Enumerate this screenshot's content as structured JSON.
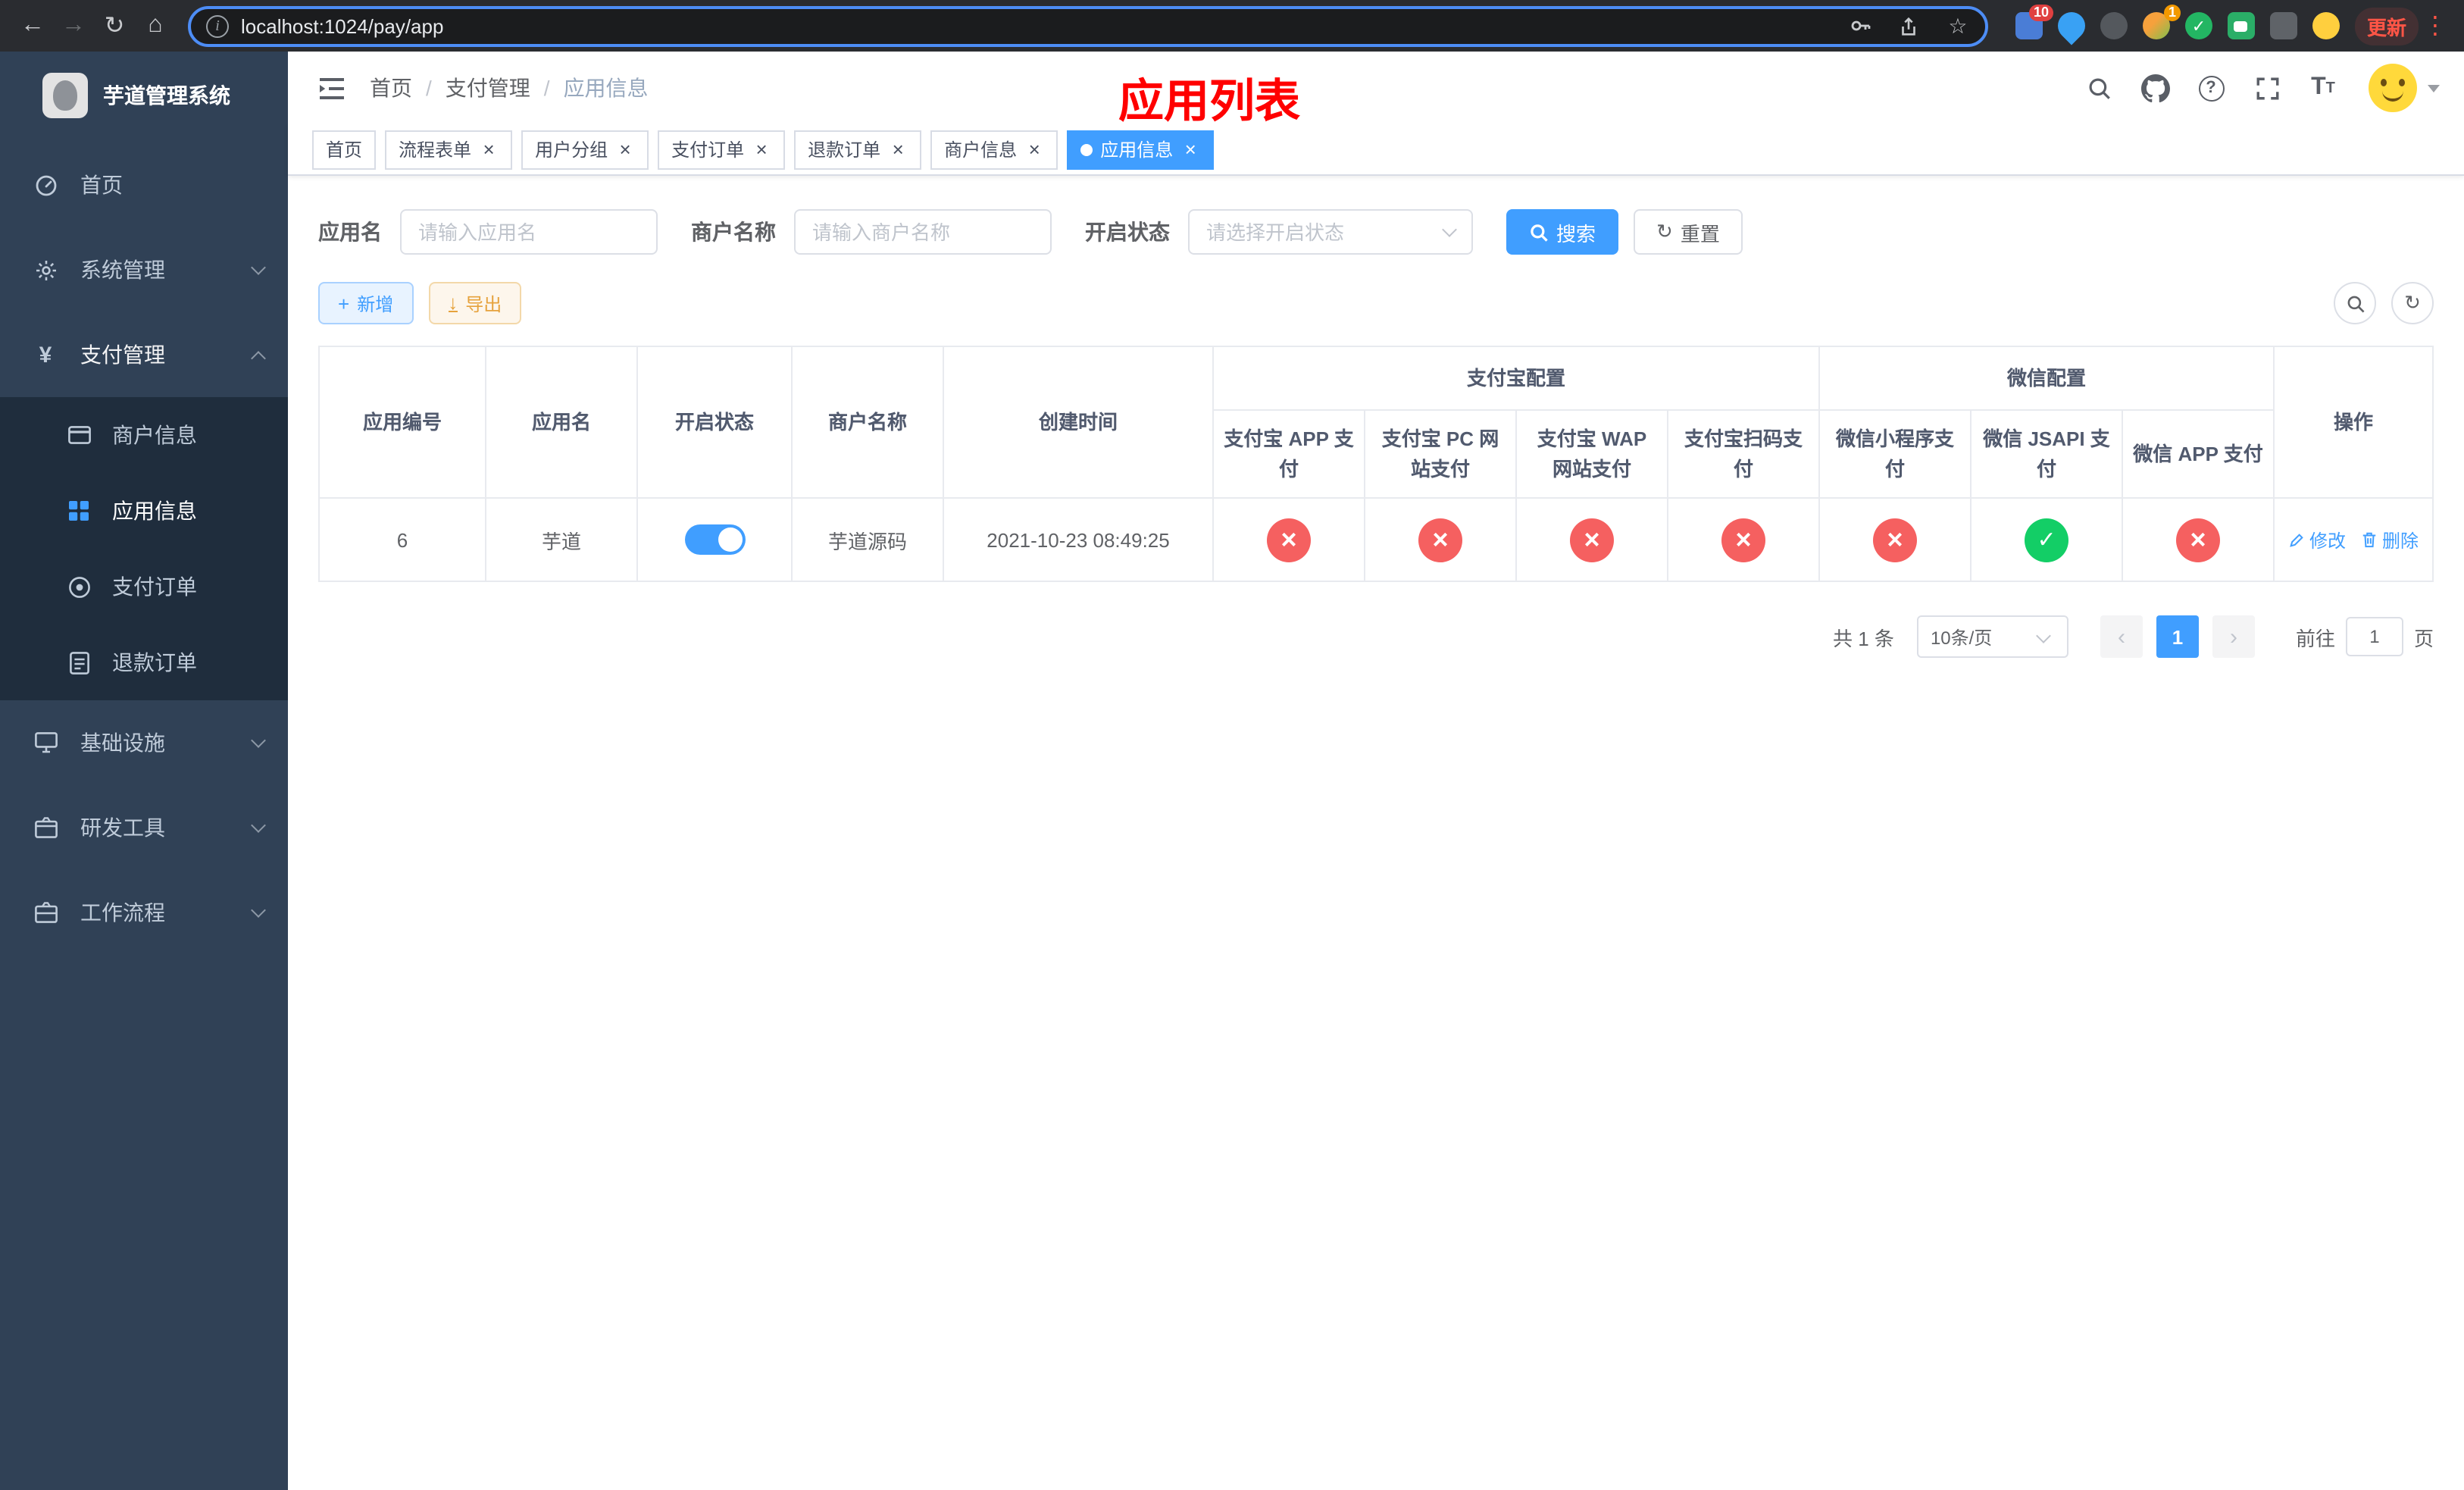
{
  "browser": {
    "url": "localhost:1024/pay/app",
    "update_label": "更新",
    "ext_badge_1": "10",
    "ext_badge_2": "1"
  },
  "sidebar": {
    "title": "芋道管理系统",
    "items": {
      "home": "首页",
      "system": "系统管理",
      "pay": "支付管理",
      "merchant": "商户信息",
      "app": "应用信息",
      "order": "支付订单",
      "refund": "退款订单",
      "infra": "基础设施",
      "devtool": "研发工具",
      "workflow": "工作流程"
    }
  },
  "header": {
    "breadcrumb": [
      "首页",
      "支付管理",
      "应用信息"
    ],
    "overlay_title": "应用列表"
  },
  "tabs": [
    {
      "label": "首页"
    },
    {
      "label": "流程表单"
    },
    {
      "label": "用户分组"
    },
    {
      "label": "支付订单"
    },
    {
      "label": "退款订单"
    },
    {
      "label": "商户信息"
    },
    {
      "label": "应用信息"
    }
  ],
  "filters": {
    "app_name_label": "应用名",
    "app_name_placeholder": "请输入应用名",
    "merchant_label": "商户名称",
    "merchant_placeholder": "请输入商户名称",
    "status_label": "开启状态",
    "status_placeholder": "请选择开启状态",
    "search_label": "搜索",
    "reset_label": "重置"
  },
  "toolbar": {
    "add_label": "新增",
    "export_label": "导出"
  },
  "table": {
    "group_alipay": "支付宝配置",
    "group_wechat": "微信配置",
    "columns": [
      "应用编号",
      "应用名",
      "开启状态",
      "商户名称",
      "创建时间",
      "支付宝 APP 支付",
      "支付宝 PC 网站支付",
      "支付宝 WAP 网站支付",
      "支付宝扫码支付",
      "微信小程序支付",
      "微信 JSAPI 支付",
      "微信 APP 支付",
      "操作"
    ],
    "row": {
      "id": "6",
      "name": "芋道",
      "enabled": true,
      "merchant": "芋道源码",
      "created": "2021-10-23 08:49:25",
      "statuses": [
        false,
        false,
        false,
        false,
        false,
        true,
        false
      ],
      "edit_label": "修改",
      "delete_label": "删除"
    }
  },
  "pagination": {
    "total_text": "共 1 条",
    "page_size": "10条/页",
    "current_page": "1",
    "goto_label": "前往",
    "goto_value": "1",
    "page_unit": "页"
  }
}
